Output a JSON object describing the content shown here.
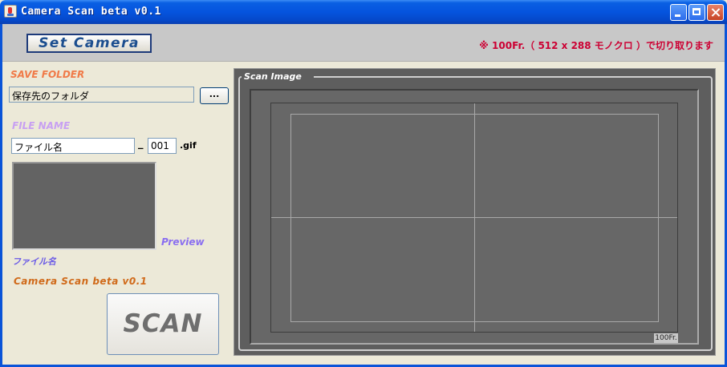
{
  "window": {
    "title": "Camera Scan beta v0.1"
  },
  "toolbar": {
    "set_camera_label": "Set Camera",
    "notice": "※ 100Fr.（ 512 x 288 モノクロ ）で切り取ります"
  },
  "save_folder": {
    "label": "SAVE FOLDER",
    "value": "保存先のフォルダ",
    "browse_label": "..."
  },
  "file_name": {
    "label": "FILE NAME",
    "name_value": "ファイル名",
    "separator": "_",
    "number_value": "001",
    "extension": ".gif"
  },
  "preview": {
    "label": "Preview",
    "file_label": "ファイル名"
  },
  "app_label": "Camera Scan beta v0.1",
  "scan_button_label": "SCAN",
  "scan_image": {
    "title": "Scan Image",
    "badge": "100Fr."
  }
}
